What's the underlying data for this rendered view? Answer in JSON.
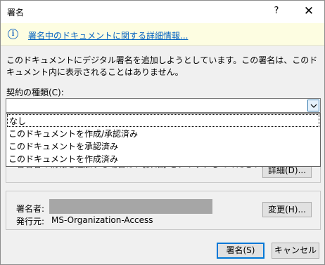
{
  "window": {
    "title": "署名",
    "help_glyph": "?",
    "close_glyph": "✕"
  },
  "infobar": {
    "icon_glyph": "i",
    "link_text": "署名中のドキュメントに関する詳細情報..."
  },
  "main": {
    "description": "このドキュメントにデジタル署名を追加しようとしています。この署名は、このドキュメント内に表示されることはありません。",
    "commitment_label": "契約の種類(C):",
    "commitment_value": "",
    "hidden_hint": "署名者の情報を追加する場合は、[詳細] をクリックしてください。",
    "details_button": "詳細(D)..."
  },
  "dropdown": {
    "options": [
      "なし",
      "このドキュメントを作成/承認済み",
      "このドキュメントを承認済み",
      "このドキュメントを作成済み"
    ]
  },
  "signer": {
    "signer_label": "署名者:",
    "issuer_label": "発行元:",
    "issuer_value": "MS-Organization-Access",
    "change_button": "変更(H)..."
  },
  "footer": {
    "sign_button": "署名(S)",
    "cancel_button": "キャンセル"
  }
}
